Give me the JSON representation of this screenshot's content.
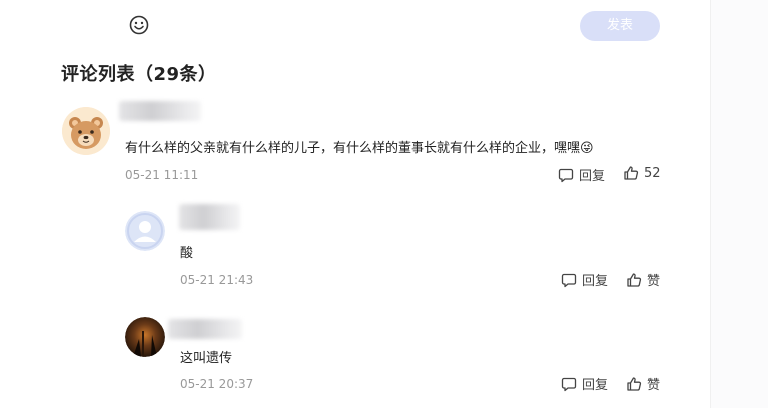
{
  "composer": {
    "emoji_icon": "smiley-face-icon",
    "publish_label": "发表"
  },
  "comments_header": {
    "title": "评论列表（29条）"
  },
  "comments": [
    {
      "content": "有什么样的父亲就有什么样的儿子，有什么样的董事长就有什么样的企业，嘿嘿😜",
      "time": "05-21 11:11",
      "reply_label": "回复",
      "like_label": "52",
      "avatar_icon": "bear-avatar"
    }
  ],
  "replies": [
    {
      "content": "酸",
      "time": "05-21 21:43",
      "reply_label": "回复",
      "like_label": "赞",
      "avatar_icon": "default-user-avatar"
    },
    {
      "content": "这叫遗传",
      "time": "05-21 20:37",
      "reply_label": "回复",
      "like_label": "赞",
      "avatar_icon": "photo-avatar"
    }
  ],
  "colors": {
    "publish_bg": "#d9dff8",
    "time_gray": "#999999"
  }
}
